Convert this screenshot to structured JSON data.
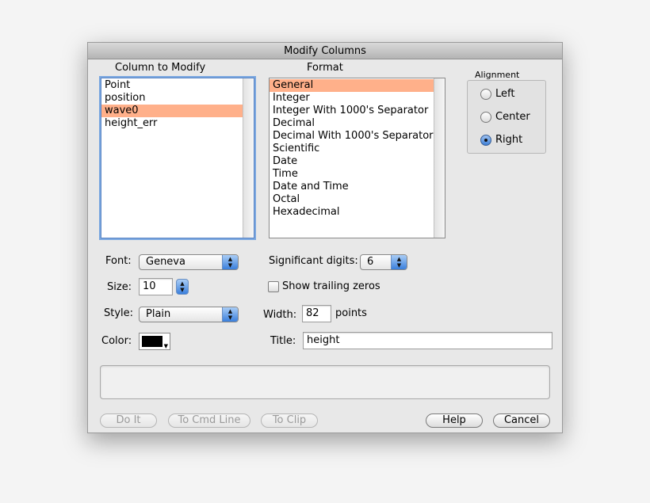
{
  "window": {
    "title": "Modify Columns"
  },
  "column_list": {
    "header": "Column to Modify",
    "items": [
      {
        "label": "Point",
        "selected": false
      },
      {
        "label": "position",
        "selected": false
      },
      {
        "label": "wave0",
        "selected": true
      },
      {
        "label": "height_err",
        "selected": false
      }
    ]
  },
  "format_list": {
    "header": "Format",
    "items": [
      {
        "label": "General",
        "selected": true
      },
      {
        "label": "Integer",
        "selected": false
      },
      {
        "label": "Integer With 1000's Separator",
        "selected": false
      },
      {
        "label": "Decimal",
        "selected": false
      },
      {
        "label": "Decimal With 1000's Separator",
        "selected": false
      },
      {
        "label": "Scientific",
        "selected": false
      },
      {
        "label": "Date",
        "selected": false
      },
      {
        "label": "Time",
        "selected": false
      },
      {
        "label": "Date and Time",
        "selected": false
      },
      {
        "label": "Octal",
        "selected": false
      },
      {
        "label": "Hexadecimal",
        "selected": false
      }
    ]
  },
  "alignment": {
    "header": "Alignment",
    "options": [
      {
        "label": "Left",
        "selected": false
      },
      {
        "label": "Center",
        "selected": false
      },
      {
        "label": "Right",
        "selected": true
      }
    ]
  },
  "font": {
    "label": "Font:",
    "value": "Geneva"
  },
  "size": {
    "label": "Size:",
    "value": "10"
  },
  "style": {
    "label": "Style:",
    "value": "Plain"
  },
  "color": {
    "label": "Color:",
    "swatch": "#000000"
  },
  "sig_digits": {
    "label": "Significant digits:",
    "value": "6"
  },
  "trailing_zeros": {
    "label": "Show trailing zeros",
    "checked": false
  },
  "width": {
    "label": "Width:",
    "value": "82",
    "unit": "points"
  },
  "title_field": {
    "label": "Title:",
    "value": "height"
  },
  "buttons": {
    "do_it": "Do It",
    "to_cmd_line": "To Cmd Line",
    "to_clip": "To Clip",
    "help": "Help",
    "cancel": "Cancel"
  },
  "colors": {
    "selection": "#ffb08a",
    "accent": "#3a7fdc"
  }
}
